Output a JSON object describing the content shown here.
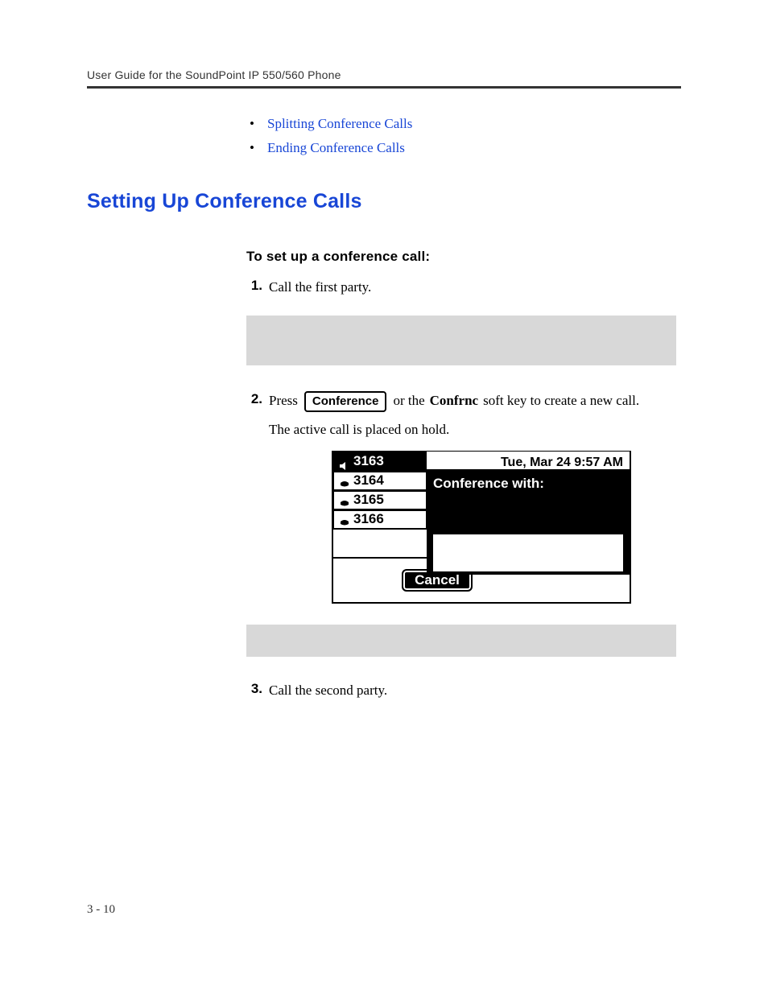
{
  "header": {
    "running_head": "User Guide for the SoundPoint IP 550/560 Phone"
  },
  "links": {
    "splitting": "Splitting Conference Calls",
    "ending": "Ending Conference Calls"
  },
  "h2": "Setting Up Conference Calls",
  "h4": "To set up a conference call:",
  "steps": {
    "s1": {
      "num": "1.",
      "text": "Call the first party."
    },
    "s2": {
      "num": "2.",
      "press": "Press",
      "button": "Conference",
      "or_the": "or the",
      "confrnc": "Confrnc",
      "rest": "soft key to create a new call.",
      "line2": "The active call is placed on hold."
    },
    "s3": {
      "num": "3.",
      "text": "Call the second party."
    }
  },
  "lcd": {
    "date": "Tue, Mar 24  9:57 AM",
    "prompt": "Conference with:",
    "soft_cancel": "Cancel",
    "lines": {
      "l1": "3163",
      "l2": "3164",
      "l3": "3165",
      "l4": "3166"
    }
  },
  "pagenum": "3 - 10"
}
